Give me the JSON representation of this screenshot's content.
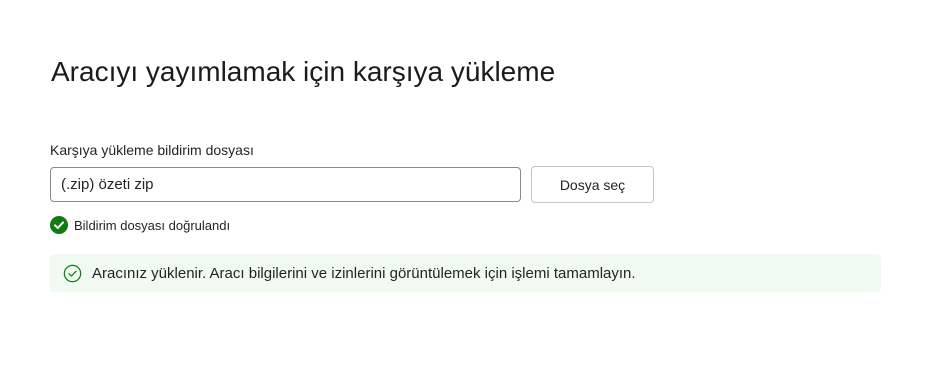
{
  "page": {
    "title": "Aracıyı yayımlamak için karşıya yükleme"
  },
  "upload": {
    "label": "Karşıya yükleme bildirim dosyası",
    "value": "(.zip) özeti zip",
    "choose_button_label": "Dosya seç"
  },
  "validation": {
    "icon": "checkmark-circle-filled-icon",
    "message": "Bildirim dosyası doğrulandı",
    "color": "#107c10"
  },
  "banner": {
    "icon": "checkmark-circle-outline-icon",
    "message": "Aracınız yüklenir. Aracı bilgilerini ve izinlerini görüntülemek için işlemi tamamlayın.",
    "background": "#f1faf1"
  }
}
